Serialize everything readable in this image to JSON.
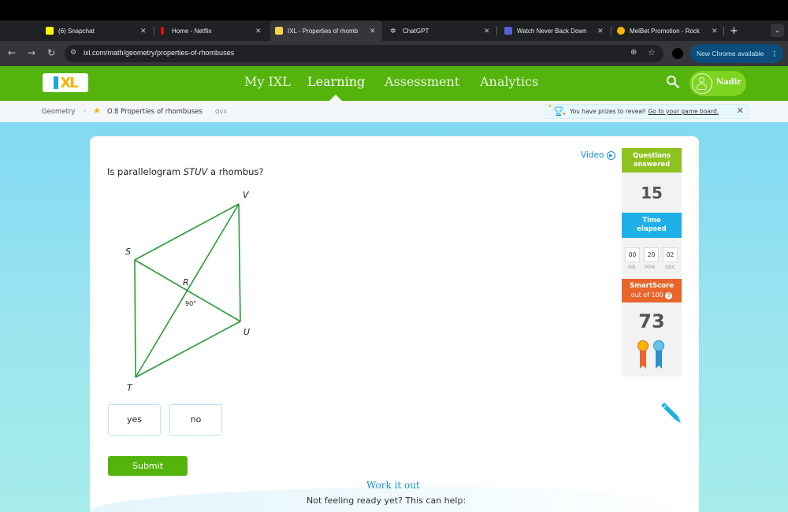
{
  "browser": {
    "tabs": [
      {
        "title": "(6) Snapchat",
        "icon": "snapchat-icon",
        "active": false
      },
      {
        "title": "Home - Netflix",
        "icon": "netflix-icon",
        "active": false
      },
      {
        "title": "IXL - Properties of rhomb",
        "icon": "ixl-icon",
        "active": true
      },
      {
        "title": "ChatGPT",
        "icon": "chatgpt-icon",
        "active": false
      },
      {
        "title": "Watch Never Back Down",
        "icon": "video-play-icon",
        "active": false
      },
      {
        "title": "MelBet Promotion - Rock",
        "icon": "melbet-icon",
        "active": false
      }
    ],
    "close_glyph": "✕",
    "new_tab_glyph": "+",
    "tab_menu_glyph": "⌄",
    "url": "ixl.com/math/geometry/properties-of-rhombuses",
    "update_label": "New Chrome available",
    "update_menu_glyph": "⋮"
  },
  "header": {
    "logo_text": "XL",
    "nav": [
      {
        "label": "My IXL",
        "active": false
      },
      {
        "label": "Learning",
        "active": true
      },
      {
        "label": "Assessment",
        "active": false
      },
      {
        "label": "Analytics",
        "active": false
      }
    ],
    "user_name": "Nadir"
  },
  "breadcrumb": {
    "subject": "Geometry",
    "separator": "›",
    "skill": "O.8 Properties of rhombuses",
    "code": "QVX"
  },
  "prize_banner": {
    "text": "You have prizes to reveal!",
    "link": "Go to your game board.",
    "close": "✕"
  },
  "question": {
    "prefix": "Is parallelogram ",
    "shape_name": "STUV",
    "suffix": " a rhombus?",
    "figure": {
      "vertices": {
        "S": "S",
        "T": "T",
        "U": "U",
        "V": "V",
        "R": "R"
      },
      "angle_label": "90°",
      "stroke_color": "#2a9a3a"
    },
    "choices": [
      "yes",
      "no"
    ],
    "submit_label": "Submit"
  },
  "help": {
    "title": "Work it out",
    "subtitle": "Not feeling ready yet? This can help:"
  },
  "sidebar": {
    "video_label": "Video",
    "questions_answered_label": [
      "Questions",
      "answered"
    ],
    "questions_answered": "15",
    "time_elapsed_label": [
      "Time",
      "elapsed"
    ],
    "time": {
      "hr": "00",
      "min": "20",
      "sec": "02"
    },
    "time_units": {
      "hr": "HR",
      "min": "MIN",
      "sec": "SEC"
    },
    "smartscore_label": "SmartScore",
    "smartscore_sub": "out of 100",
    "smartscore_help": "?",
    "smartscore": "73"
  },
  "colors": {
    "ixl_green": "#54b40c",
    "questions_green": "#8dc21f",
    "time_blue": "#1eb0e6",
    "smartscore_orange": "#e8652c",
    "link_blue": "#1a8fd8"
  }
}
